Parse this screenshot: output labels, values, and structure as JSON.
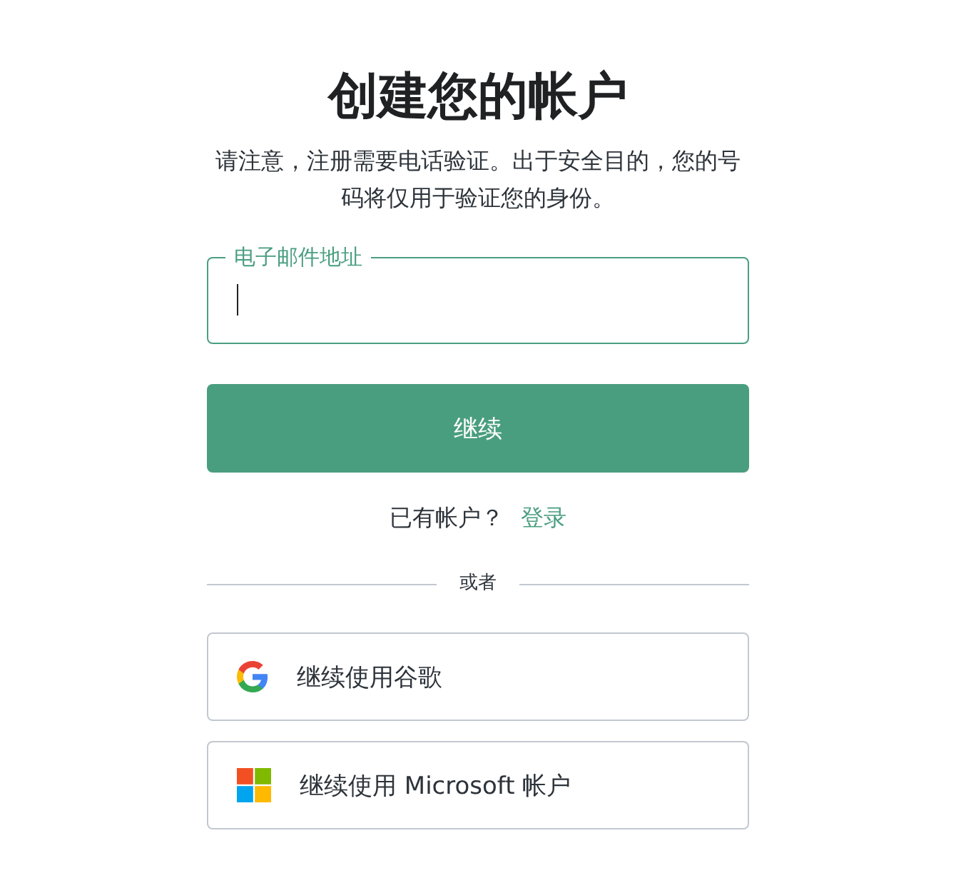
{
  "title": "创建您的帐户",
  "notice": "请注意，注册需要电话验证。出于安全目的，您的号码将仅用于验证您的身份。",
  "email_field": {
    "label": "电子邮件地址",
    "focused": true
  },
  "continue_button": "继续",
  "login_prompt": {
    "text": "已有帐户？",
    "link": "登录"
  },
  "divider": "或者",
  "providers": [
    {
      "kind": "google",
      "label": "继续使用谷歌"
    },
    {
      "kind": "microsoft",
      "label": "继续使用 Microsoft 帐户"
    }
  ]
}
